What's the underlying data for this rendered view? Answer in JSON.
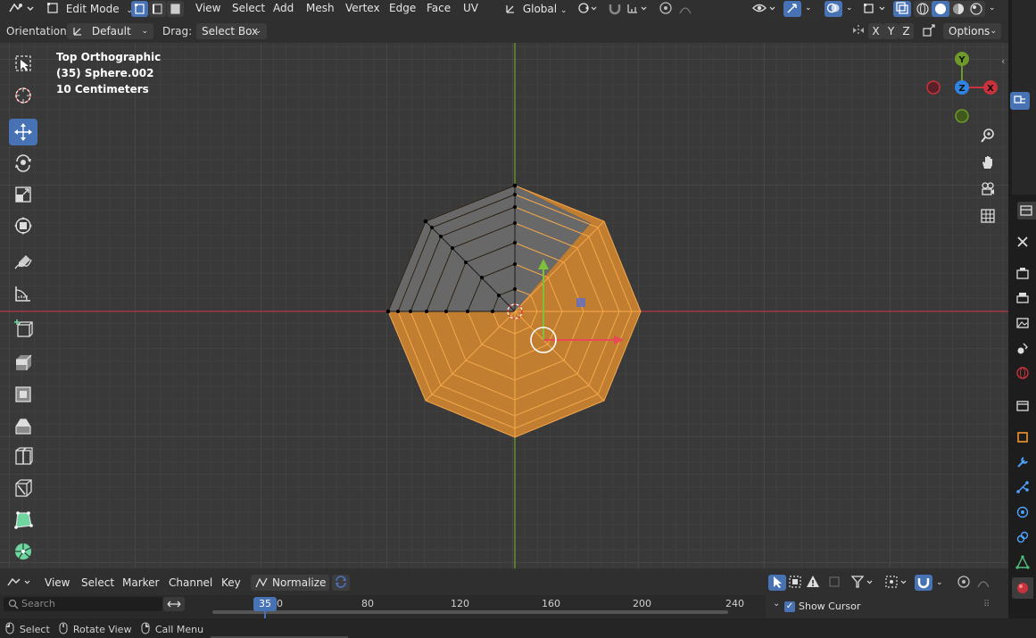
{
  "header": {
    "mode": "Edit Mode",
    "menus": [
      "View",
      "Select",
      "Add",
      "Mesh",
      "Vertex",
      "Edge",
      "Face",
      "UV"
    ],
    "transform_orientation": "Global"
  },
  "tool_settings": {
    "orientation_label": "Orientation:",
    "orientation_value": "Default",
    "drag_label": "Drag:",
    "drag_value": "Select Box",
    "axes": [
      "X",
      "Y",
      "Z"
    ],
    "options_label": "Options"
  },
  "viewport": {
    "view_name": "Top Orthographic",
    "object_info": "(35) Sphere.002",
    "grid_scale": "10 Centimeters",
    "gizmo_axes": {
      "y": "Y",
      "z": "Z",
      "x": "X"
    }
  },
  "timeline": {
    "menus": [
      "View",
      "Select",
      "Marker",
      "Channel",
      "Key"
    ],
    "normalize_label": "Normalize",
    "search_placeholder": "Search",
    "current_frame": "35",
    "ruler_labels": [
      "0",
      "80",
      "120",
      "160",
      "200",
      "240"
    ],
    "show_cursor_label": "Show Cursor"
  },
  "status_bar": {
    "items": [
      "Select",
      "Rotate View",
      "Call Menu"
    ]
  },
  "colors": {
    "accent_blue": "#4772b3",
    "selection_orange": "#f0962d",
    "x_axis": "#c8323c",
    "y_axis": "#6e9a2a",
    "z_axis": "#2f84e3"
  }
}
